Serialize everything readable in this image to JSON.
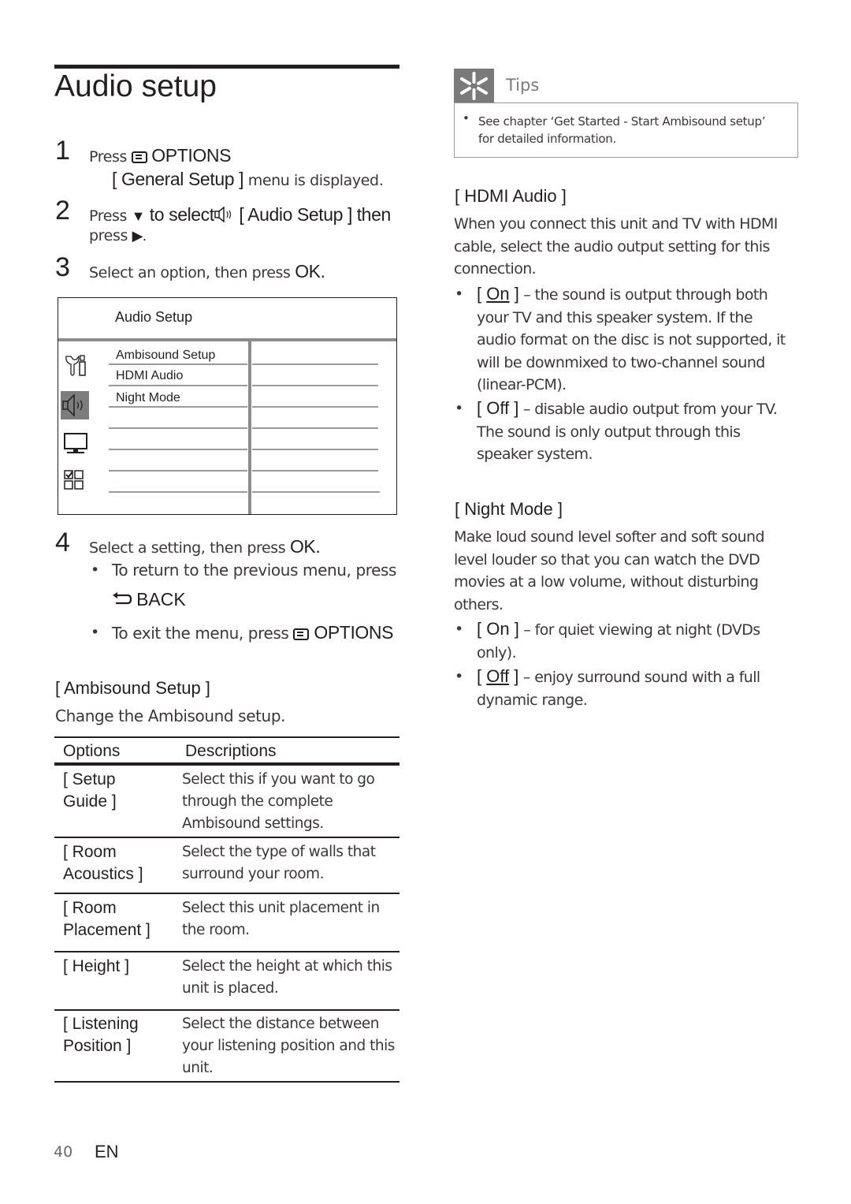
{
  "page": {
    "title": "Audio setup",
    "page_number": "40",
    "language": "EN"
  },
  "steps": [
    {
      "num": "1",
      "pre": "Press",
      "icon": "options-key-icon",
      "key": "OPTIONS",
      "result_bold": "[ General Setup ]",
      "result_text": "menu is displayed."
    },
    {
      "num": "2",
      "pre": "Press",
      "arrow_down": "▼",
      "mid": "to select",
      "icon": "speaker-icon",
      "menu_name": "[ Audio Setup ]",
      "then": "then",
      "line2_pre": "press",
      "arrow_right": "▶."
    },
    {
      "num": "3",
      "text": "Select an option, then press",
      "key": "OK."
    },
    {
      "num": "4",
      "text": "Select a setting, then press",
      "key": "OK.",
      "bullets": [
        {
          "text": "To return to the previous menu, press",
          "icon": "back-arrow-icon",
          "key": "BACK"
        },
        {
          "text": "To exit the menu, press",
          "icon": "options-key-icon",
          "key": "OPTIONS"
        }
      ]
    }
  ],
  "osd_menu": {
    "title": "Audio Setup",
    "side_icons": [
      "general-setup-icon",
      "audio-setup-icon",
      "video-setup-icon",
      "preference-setup-icon"
    ],
    "selected_icon_index": 1,
    "items": [
      "Ambisound Setup",
      "HDMI Audio",
      "Night Mode",
      "",
      "",
      "",
      ""
    ]
  },
  "ambisound": {
    "heading": "[ Ambisound Setup ]",
    "intro": "Change the Ambisound setup.",
    "table": {
      "headers": [
        "Options",
        "Descriptions"
      ],
      "rows": [
        {
          "option": [
            "[ Setup",
            "Guide ]"
          ],
          "description": [
            "Select this if you want to go",
            "through the complete",
            "Ambisound settings."
          ]
        },
        {
          "option": [
            "[ Room",
            "Acoustics ]"
          ],
          "description": [
            "Select the type of walls that",
            "surround your room."
          ]
        },
        {
          "option": [
            "[ Room",
            "Placement ]"
          ],
          "description": [
            "Select this unit placement in",
            "the room."
          ]
        },
        {
          "option": [
            "[ Height ]"
          ],
          "description": [
            "Select the height at which this",
            "unit is placed."
          ]
        },
        {
          "option": [
            "[ Listening",
            "Position ]"
          ],
          "description": [
            "Select the distance between",
            "your listening position and this",
            "unit."
          ]
        }
      ]
    }
  },
  "tips": {
    "label": "Tips",
    "icon": "asterisk-icon",
    "items": [
      "See chapter ‘Get Started - Start Ambisound setup’",
      "for detailed information."
    ]
  },
  "hdmi_audio": {
    "heading": "[ HDMI Audio ]",
    "intro": [
      "When you connect this unit and TV with HDMI",
      "cable, select the audio output setting for this",
      "connection."
    ],
    "options": [
      {
        "bracket_open": "[ ",
        "name": "On",
        "bracket_close": " ]",
        "default": true,
        "lines": [
          "– the sound is output through both",
          "your TV and this speaker system. If the",
          "audio format on the disc is not supported, it",
          "will be downmixed to two-channel sound",
          "(linear-PCM)."
        ]
      },
      {
        "bracket_open": "[ ",
        "name": "Off",
        "bracket_close": " ]",
        "default": false,
        "lines": [
          "– disable audio output from your TV.",
          "The sound is only output through this",
          "speaker system."
        ]
      }
    ]
  },
  "night_mode": {
    "heading": "[ Night Mode ]",
    "intro": [
      "Make loud sound level softer and soft sound",
      "level louder so that you can watch the DVD",
      "movies at a low volume, without disturbing",
      "others."
    ],
    "options": [
      {
        "bracket_open": "[ ",
        "name": "On",
        "bracket_close": " ]",
        "default": false,
        "lines": [
          "– for quiet viewing at night (DVDs",
          "only)."
        ]
      },
      {
        "bracket_open": "[ ",
        "name": "Off",
        "bracket_close": " ]",
        "default": true,
        "lines": [
          "– enjoy surround sound with a full",
          "dynamic range."
        ]
      }
    ]
  }
}
